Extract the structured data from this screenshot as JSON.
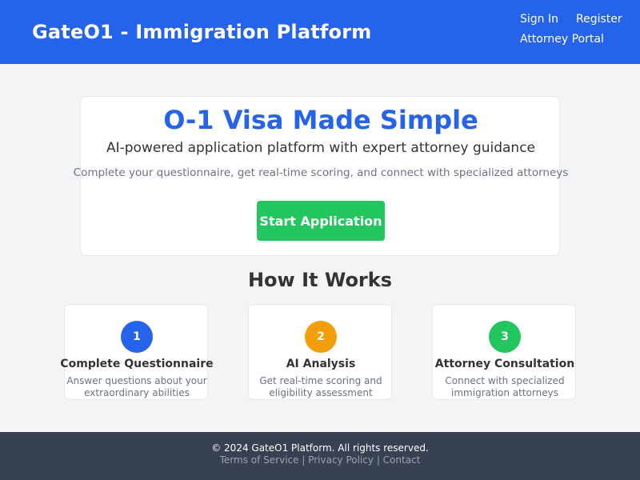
{
  "header": {
    "brand": "GateO1 - Immigration Platform",
    "nav": {
      "sign_in": "Sign In",
      "register": "Register",
      "attorney_portal": "Attorney Portal"
    }
  },
  "hero": {
    "title": "O-1 Visa Made Simple",
    "subtitle": "AI-powered application platform with expert attorney guidance",
    "description": "Complete your questionnaire, get real-time scoring, and connect with specialized attorneys",
    "cta_label": "Start Application"
  },
  "how_it_works": {
    "title": "How It Works",
    "steps": [
      {
        "number": "1",
        "title": "Complete Questionnaire",
        "description": "Answer questions about your extraordinary abilities",
        "color": "#2563eb"
      },
      {
        "number": "2",
        "title": "AI Analysis",
        "description": "Get real-time scoring and eligibility assessment",
        "color": "#f59e0b"
      },
      {
        "number": "3",
        "title": "Attorney Consultation",
        "description": "Connect with specialized immigration attorneys",
        "color": "#22c55e"
      }
    ]
  },
  "footer": {
    "copyright": "© 2024 GateO1 Platform. All rights reserved.",
    "links": [
      "Terms of Service",
      "Privacy Policy",
      "Contact"
    ],
    "separator": "|"
  },
  "colors": {
    "primary": "#2563eb",
    "success": "#22c55e",
    "warning": "#f59e0b",
    "footer_bg": "#374151",
    "page_bg": "#f3f4f6"
  }
}
